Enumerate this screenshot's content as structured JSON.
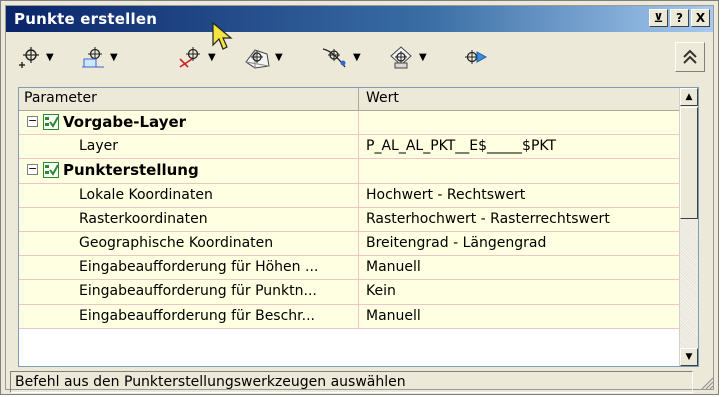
{
  "window": {
    "title": "Punkte erstellen",
    "buttons": [
      "⊻",
      "?",
      "X"
    ]
  },
  "toolbar": {
    "tools": [
      {
        "icon": "create-point-icon",
        "has_dropdown": true
      },
      {
        "icon": "point-interpolate-icon",
        "has_dropdown": true
      },
      {
        "icon": "point-slope-icon",
        "has_dropdown": true
      },
      {
        "icon": "surface-point-icon",
        "has_dropdown": true
      },
      {
        "icon": "alignment-point-icon",
        "has_dropdown": true
      },
      {
        "icon": "polyline-point-icon",
        "has_dropdown": true
      },
      {
        "icon": "transfer-point-icon",
        "has_dropdown": false
      }
    ],
    "dropdown_glyph": "▼",
    "collapse_icon": "chevron-double-up-icon"
  },
  "grid": {
    "headers": [
      "Parameter",
      "Wert"
    ],
    "rows": [
      {
        "kind": "category",
        "label": "Vorgabe-Layer",
        "value": "",
        "expand": "⊟"
      },
      {
        "kind": "property",
        "label": "Layer",
        "value": "P_AL_AL_PKT__E$_____$PKT"
      },
      {
        "kind": "category",
        "label": "Punkterstellung",
        "value": "",
        "expand": "⊟"
      },
      {
        "kind": "property",
        "label": "Lokale Koordinaten",
        "value": "Hochwert - Rechtswert"
      },
      {
        "kind": "property",
        "label": "Rasterkoordinaten",
        "value": "Rasterhochwert - Rasterrechtswert"
      },
      {
        "kind": "property",
        "label": "Geographische Koordinaten",
        "value": "Breitengrad - Längengrad"
      },
      {
        "kind": "property",
        "label": "Eingabeaufforderung für Höhen ...",
        "value": "Manuell"
      },
      {
        "kind": "property",
        "label": "Eingabeaufforderung für Punktn...",
        "value": "Kein"
      },
      {
        "kind": "property",
        "label": "Eingabeaufforderung für Beschr...",
        "value": "Manuell"
      }
    ],
    "scroll_up": "▲",
    "scroll_down": "▼"
  },
  "statusbar": {
    "text": "Befehl aus den Punkterstellungswerkzeugen auswählen"
  },
  "colors": {
    "title_gradient_start": "#0a246a",
    "title_gradient_end": "#a6caf0",
    "grid_row_bg": "#ffffe1",
    "grid_line": "#f2c4c4",
    "category_icon": "#2ba02b"
  }
}
